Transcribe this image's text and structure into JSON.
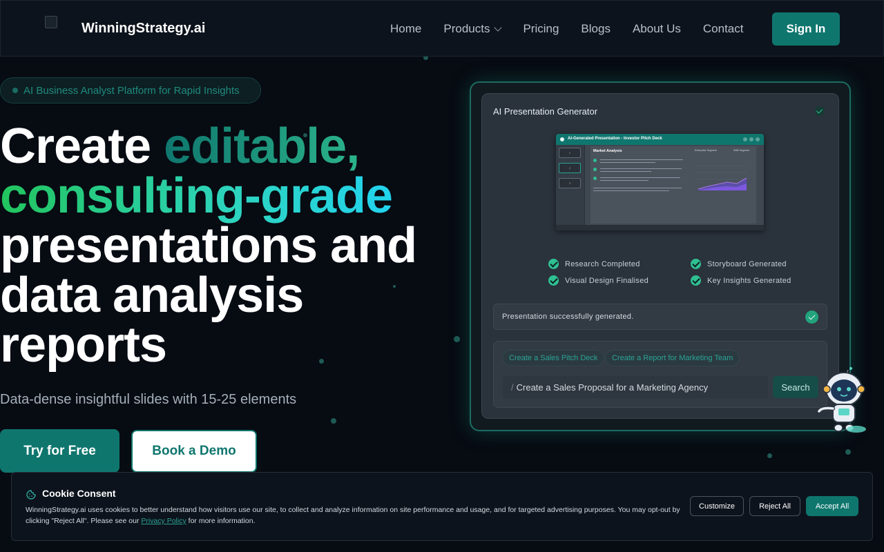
{
  "nav": {
    "brand": "WinningStrategy.ai",
    "links": [
      {
        "label": "Home"
      },
      {
        "label": "Products"
      },
      {
        "label": "Pricing"
      },
      {
        "label": "Blogs"
      },
      {
        "label": "About Us"
      },
      {
        "label": "Contact"
      }
    ],
    "signin": "Sign In"
  },
  "hero": {
    "badge": "AI Business Analyst Platform for Rapid Insights",
    "title": {
      "line1_plain": "Create ",
      "line1_accent": "editable,",
      "line2_accent": "consulting-grade",
      "line3": "presentations and",
      "line4": "data analysis",
      "line5": "reports"
    },
    "subtitle": "Data-dense insightful slides with 15-25 elements",
    "cta_primary": "Try for Free",
    "cta_secondary": "Book a Demo"
  },
  "card": {
    "title": "AI Presentation Generator",
    "preview": {
      "window_title": "AI-Generated Presentation - Investor Pitch Deck",
      "slide_heading": "Market Analysis",
      "thumbs": [
        "1",
        "2",
        "3"
      ],
      "legend_a": "Enterprise Segment",
      "legend_b": "SMB Segment"
    },
    "checklist": [
      {
        "label": "Research Completed"
      },
      {
        "label": "Storyboard Generated"
      },
      {
        "label": "Visual Design Finalised"
      },
      {
        "label": "Key Insights Generated"
      }
    ],
    "status": "Presentation successfully generated.",
    "chips": [
      "Create a Sales Pitch Deck",
      "Create a Report for Marketing Team"
    ],
    "prompt_slash": "/",
    "prompt_value": "Create a Sales Proposal for a Marketing Agency",
    "search": "Search"
  },
  "cookie": {
    "title": "Cookie Consent",
    "text_before": "WinningStrategy.ai uses cookies to better understand how visitors use our site, to collect and analyze information on site performance and usage, and for targeted advertising purposes. You may opt-out by clicking \"Reject All\". Please see our ",
    "link": "Privacy Policy",
    "text_after": " for more information.",
    "customize": "Customize",
    "reject": "Reject All",
    "accept": "Accept All"
  },
  "colors": {
    "accent": "#0f766e",
    "background": "#070b12",
    "success": "#2fbf91"
  }
}
